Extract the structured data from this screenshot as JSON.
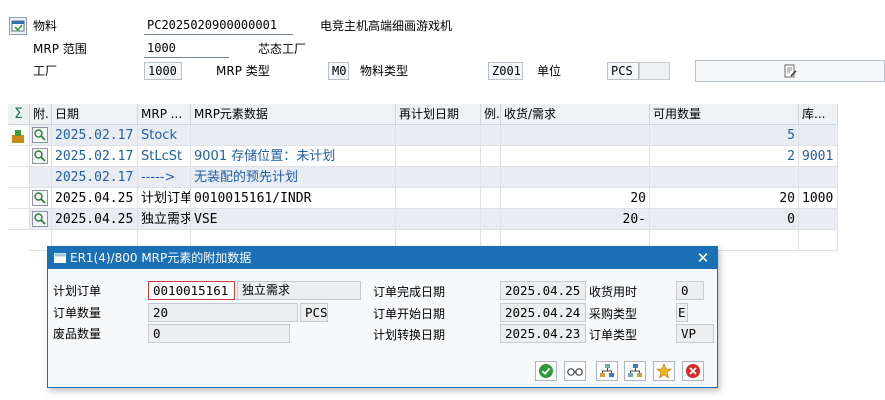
{
  "header": {
    "material_label": "物料",
    "material_value": "PC2025020900000001",
    "material_desc": "电竞主机高端细画游戏机",
    "mrp_area_label": "MRP 范围",
    "mrp_area_value": "1000",
    "mrp_area_desc": "芯态工厂",
    "plant_label": "工厂",
    "plant_value": "1000",
    "mrp_type_label": "MRP 类型",
    "mrp_type_value": "M0",
    "material_type_label": "物料类型",
    "material_type_value": "Z001",
    "unit_label": "单位",
    "unit_value": "PCS"
  },
  "grid": {
    "sum_symbol": "Σ",
    "columns": [
      "附.",
      "日期",
      "MRP ...",
      "MRP元素数据",
      "再计划日期",
      "例.",
      "收货/需求",
      "可用数量",
      "库..."
    ],
    "rows": [
      {
        "date": "2025.02.17",
        "mrp": "Stock",
        "data": "",
        "resched": "",
        "ex": "",
        "recreq": "",
        "avail": "5",
        "stor": "",
        "style": "grey",
        "blue": true,
        "icon": true
      },
      {
        "date": "2025.02.17",
        "mrp": "StLcSt",
        "data": "9001 存储位置：未计划",
        "resched": "",
        "ex": "",
        "recreq": "",
        "avail": "2",
        "stor": "9001",
        "style": "white",
        "blue": true,
        "icon": true
      },
      {
        "date": "2025.02.17",
        "mrp": "----->",
        "data": "无装配的预先计划",
        "resched": "",
        "ex": "",
        "recreq": "",
        "avail": "",
        "stor": "",
        "style": "grey",
        "blue": true,
        "icon": false
      },
      {
        "date": "2025.04.25",
        "mrp": "计划订单",
        "data": "0010015161/INDR",
        "resched": "",
        "ex": "",
        "recreq": "20",
        "avail": "20",
        "stor": "1000",
        "style": "white",
        "blue": false,
        "icon": true
      },
      {
        "date": "2025.04.25",
        "mrp": "独立需求",
        "data": "VSE",
        "resched": "",
        "ex": "",
        "recreq": "20-",
        "avail": "0",
        "stor": "",
        "style": "grey",
        "blue": false,
        "icon": true
      }
    ]
  },
  "dialog": {
    "title": "ER1(4)/800 MRP元素的附加数据",
    "planned_order_label": "计划订单",
    "planned_order_value": "0010015161",
    "planned_order_desc": "独立需求",
    "order_qty_label": "订单数量",
    "order_qty_value": "20",
    "order_qty_unit": "PCS",
    "scrap_qty_label": "废品数量",
    "scrap_qty_value": "0",
    "finish_date_label": "订单完成日期",
    "finish_date_value": "2025.04.25",
    "start_date_label": "订单开始日期",
    "start_date_value": "2025.04.24",
    "convert_date_label": "计划转换日期",
    "convert_date_value": "2025.04.23",
    "gr_time_label": "收货用时",
    "gr_time_value": "0",
    "proc_type_label": "采购类型",
    "proc_type_value": "E",
    "order_type_label": "订单类型",
    "order_type_value": "VP"
  },
  "icons": {
    "accept": "check-icon",
    "glasses": "display-icon",
    "tree1": "hierarchy-icon",
    "tree2": "hierarchy-alt-icon",
    "favorite": "star-icon",
    "cancel": "cancel-icon",
    "close": "close-icon"
  },
  "colors": {
    "dialog_title_bg": "#1b6fb5",
    "accent_blue_text": "#1f5ea8",
    "accept_green": "#2e9b3a",
    "cancel_red": "#d42c2c"
  }
}
